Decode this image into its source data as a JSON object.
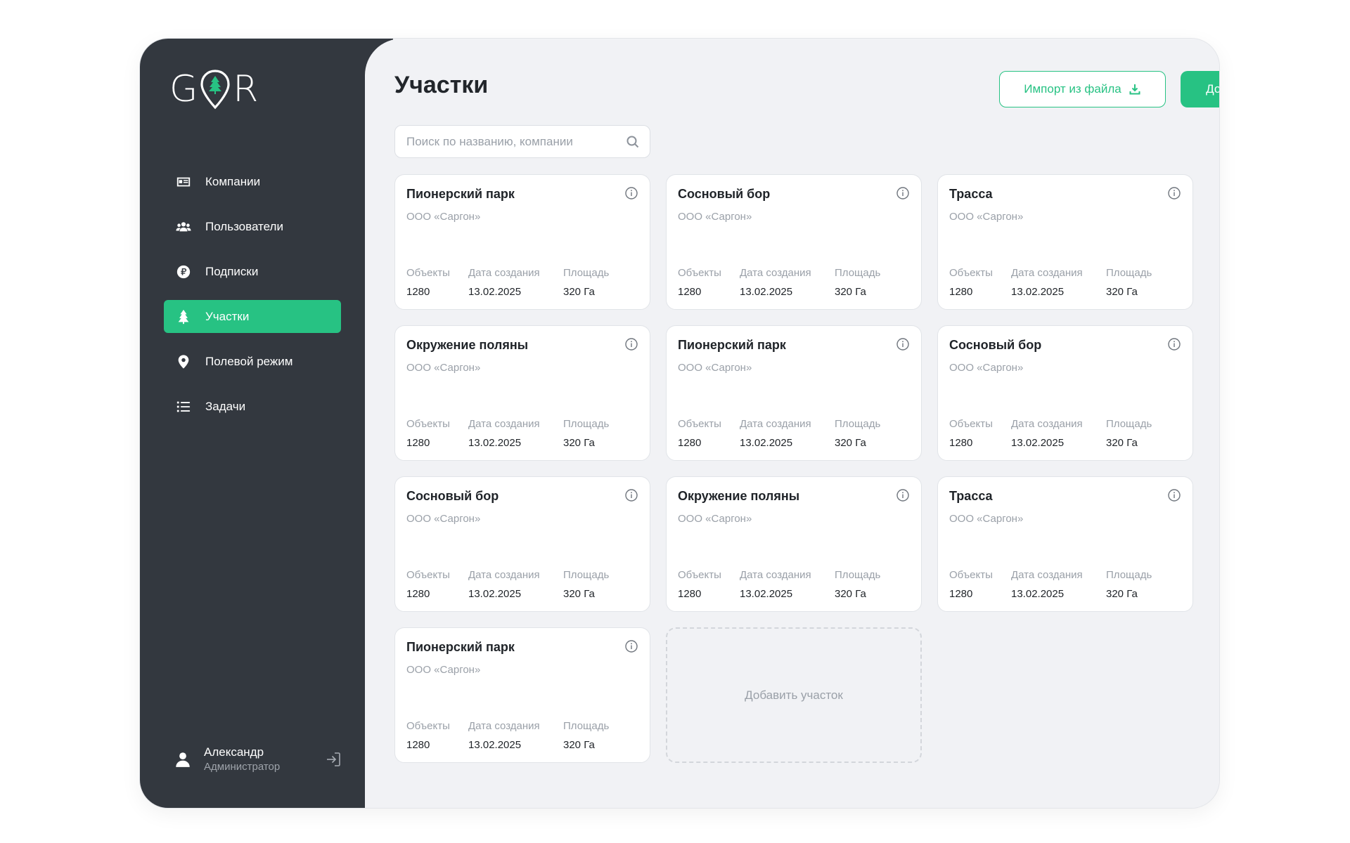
{
  "logo": {
    "left": "G",
    "right": "R"
  },
  "nav": {
    "items": [
      {
        "label": "Компании",
        "icon": "id-card-icon",
        "active": false
      },
      {
        "label": "Пользователи",
        "icon": "users-icon",
        "active": false
      },
      {
        "label": "Подписки",
        "icon": "ruble-icon",
        "active": false
      },
      {
        "label": "Участки",
        "icon": "tree-icon",
        "active": true
      },
      {
        "label": "Полевой режим",
        "icon": "map-pin-icon",
        "active": false
      },
      {
        "label": "Задачи",
        "icon": "list-icon",
        "active": false
      }
    ]
  },
  "user": {
    "name": "Александр",
    "role": "Администратор"
  },
  "header": {
    "title": "Участки",
    "import_label": "Импорт из файла",
    "add_label": "Добавить участок"
  },
  "search": {
    "placeholder": "Поиск по названию, компании"
  },
  "view": {
    "mode": "grid"
  },
  "stat_labels": {
    "objects": "Объекты",
    "created": "Дата создания",
    "area": "Площадь"
  },
  "cards": [
    {
      "title": "Пионерский парк",
      "company": "ООО «Саргон»",
      "objects": "1280",
      "created": "13.02.2025",
      "area": "320 Га"
    },
    {
      "title": "Сосновый бор",
      "company": "ООО «Саргон»",
      "objects": "1280",
      "created": "13.02.2025",
      "area": "320 Га"
    },
    {
      "title": "Трасса",
      "company": "ООО «Саргон»",
      "objects": "1280",
      "created": "13.02.2025",
      "area": "320 Га"
    },
    {
      "title": "Окружение поляны",
      "company": "ООО «Саргон»",
      "objects": "1280",
      "created": "13.02.2025",
      "area": "320 Га"
    },
    {
      "title": "Пионерский парк",
      "company": "ООО «Саргон»",
      "objects": "1280",
      "created": "13.02.2025",
      "area": "320 Га"
    },
    {
      "title": "Сосновый бор",
      "company": "ООО «Саргон»",
      "objects": "1280",
      "created": "13.02.2025",
      "area": "320 Га"
    },
    {
      "title": "Сосновый бор",
      "company": "ООО «Саргон»",
      "objects": "1280",
      "created": "13.02.2025",
      "area": "320 Га"
    },
    {
      "title": "Окружение поляны",
      "company": "ООО «Саргон»",
      "objects": "1280",
      "created": "13.02.2025",
      "area": "320 Га"
    },
    {
      "title": "Трасса",
      "company": "ООО «Саргон»",
      "objects": "1280",
      "created": "13.02.2025",
      "area": "320 Га"
    },
    {
      "title": "Пионерский парк",
      "company": "ООО «Саргон»",
      "objects": "1280",
      "created": "13.02.2025",
      "area": "320 Га"
    }
  ],
  "add_card_label": "Добавить участок",
  "colors": {
    "accent": "#27c283",
    "sidebar": "#33383f",
    "background": "#f1f2f5"
  }
}
